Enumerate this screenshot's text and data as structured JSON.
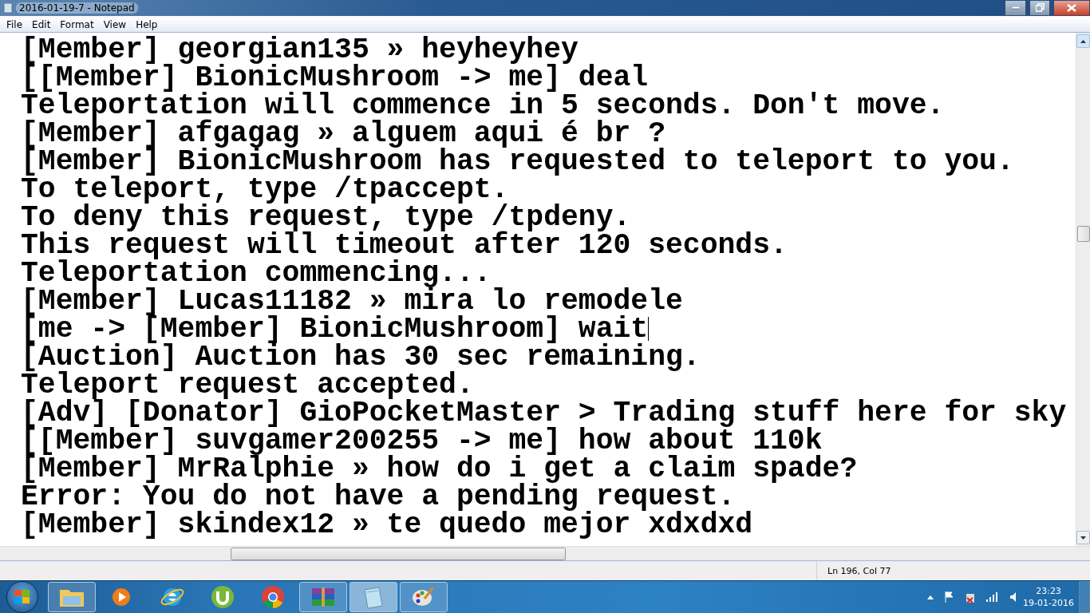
{
  "window": {
    "title": "2016-01-19-7 - Notepad"
  },
  "menu": [
    "File",
    "Edit",
    "Format",
    "View",
    "Help"
  ],
  "lines": [
    {
      "text": "[Member] georgian135 » heyheyhey",
      "caret": false
    },
    {
      "text": "[[Member] BionicMushroom -> me] deal",
      "caret": false
    },
    {
      "text": "Teleportation will commence in 5 seconds. Don't move.",
      "caret": false
    },
    {
      "text": "[Member] afgagag » alguem aqui é br ?",
      "caret": false
    },
    {
      "text": "[Member] BionicMushroom has requested to teleport to you.",
      "caret": false
    },
    {
      "text": "To teleport, type /tpaccept.",
      "caret": false
    },
    {
      "text": "To deny this request, type /tpdeny.",
      "caret": false
    },
    {
      "text": "This request will timeout after 120 seconds.",
      "caret": false
    },
    {
      "text": "Teleportation commencing...",
      "caret": false
    },
    {
      "text": "[Member] Lucas11182 » mira lo remodele",
      "caret": false
    },
    {
      "text": "[me -> [Member] BionicMushroom] wait",
      "caret": true
    },
    {
      "text": "[Auction] Auction has 30 sec remaining.",
      "caret": false
    },
    {
      "text": "Teleport request accepted.",
      "caret": false
    },
    {
      "text": "[Adv] [Donator] GioPocketMaster > Trading stuff here for sky",
      "caret": false
    },
    {
      "text": "[[Member] suvgamer200255 -> me] how about 110k",
      "caret": false
    },
    {
      "text": "[Member] MrRalphie » how do i get a claim spade?",
      "caret": false
    },
    {
      "text": "Error: You do not have a pending request.",
      "caret": false
    },
    {
      "text": "[Member] skindex12 » te quedo mejor xdxdxd",
      "caret": false
    }
  ],
  "status_bar": {
    "position": "Ln 196, Col 77"
  },
  "taskbar": {
    "apps": [
      {
        "kind": "folder",
        "running": true,
        "active": false
      },
      {
        "kind": "media",
        "running": false,
        "active": false
      },
      {
        "kind": "browser-e",
        "running": false,
        "active": false
      },
      {
        "kind": "torrent",
        "running": false,
        "active": false
      },
      {
        "kind": "chrome",
        "running": false,
        "active": false
      },
      {
        "kind": "books",
        "running": true,
        "active": false
      },
      {
        "kind": "notepad",
        "running": true,
        "active": true
      },
      {
        "kind": "paint",
        "running": true,
        "active": false
      }
    ],
    "clock": {
      "time": "23:23",
      "date": "19-01-2016"
    }
  }
}
